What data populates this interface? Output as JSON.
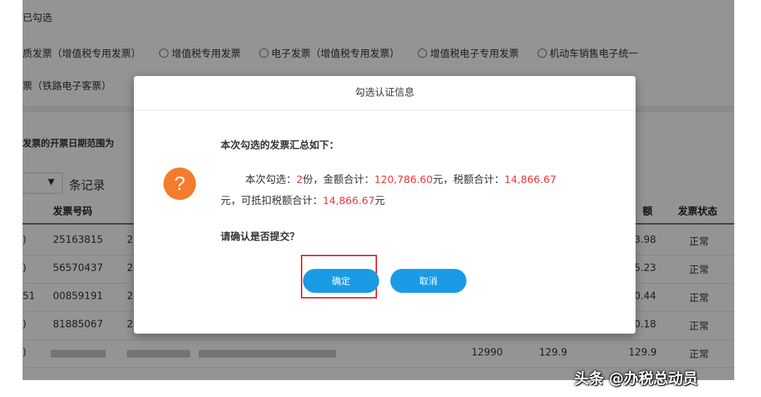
{
  "background": {
    "checked_label": "已勾选",
    "radio_options": [
      "质发票（增值税专用发票）",
      "增值税专用发票",
      "电子发票（增值税专用发票）",
      "增值税电子专用发票",
      "机动车销售电子统一"
    ],
    "railway_option": "票（铁路电子客票）",
    "date_range_note": "发票的开票日期范围为",
    "records_label": "条记录",
    "headers": {
      "invoice_no": "发票号码",
      "amount": "额",
      "status": "发票状态"
    },
    "rows": [
      {
        "lead": ")",
        "number": "25163815",
        "date": "2",
        "tax": "3.98",
        "status": "正常"
      },
      {
        "lead": ")",
        "number": "56570437",
        "date": "2",
        "tax": "5.23",
        "status": "正常"
      },
      {
        "lead": "51",
        "number": "00859191",
        "date": "2",
        "tax": "0.44",
        "status": "正常"
      },
      {
        "lead": ")",
        "number": "81885067",
        "date": "2",
        "tax": "0.18",
        "status": "正常"
      },
      {
        "lead": ")",
        "col_a": "12990",
        "col_b": "129.9",
        "tax": "129.9",
        "status": "正常"
      }
    ]
  },
  "dialog": {
    "title": "勾选认证信息",
    "summary_heading": "本次勾选的发票汇总如下：",
    "line1_prefix": "本次勾选：",
    "count": "2",
    "count_unit": "份，金额合计：",
    "total_amount": "120,786.60",
    "amount_unit": "元，税额合计：",
    "total_tax": "14,866.67",
    "line2_prefix": "元，可抵扣税额合计：",
    "deductible_tax": "14,866.67",
    "line2_suffix": "元",
    "confirm_question": "请确认是否提交？",
    "confirm_button": "确定",
    "cancel_button": "取消",
    "icon": "question-icon"
  },
  "watermark": "头条 @办税总动员",
  "colors": {
    "accent_blue": "#1a9be6",
    "warning_orange": "#f47c2c",
    "value_red": "#f0353a",
    "highlight_red": "#e8272d"
  }
}
